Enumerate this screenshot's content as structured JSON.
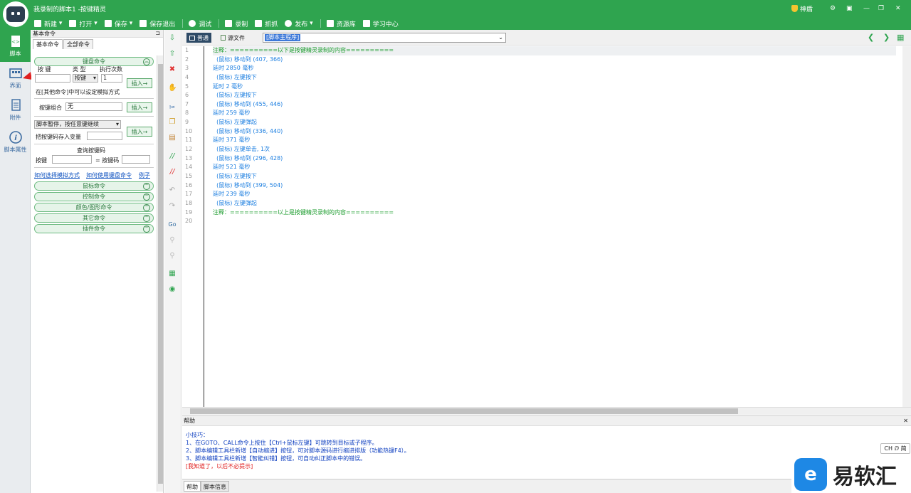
{
  "window": {
    "title": "我录制的脚本1 -按键精灵",
    "right_controls": {
      "shield_label": "神盾",
      "minimize": "—",
      "restore": "❐",
      "close": "✕"
    }
  },
  "toolbar": {
    "items": [
      {
        "label": "新建",
        "icon": "plus-icon"
      },
      {
        "label": "打开",
        "icon": "folder-icon"
      },
      {
        "label": "保存",
        "icon": "save-icon"
      },
      {
        "label": "保存退出",
        "icon": "save-exit-icon"
      },
      {
        "label": "调试",
        "icon": "play-icon"
      },
      {
        "label": "录制",
        "icon": "record-icon"
      },
      {
        "label": "抓抓",
        "icon": "grab-icon"
      },
      {
        "label": "发布",
        "icon": "publish-icon"
      },
      {
        "label": "资源库",
        "icon": "resource-icon"
      },
      {
        "label": "学习中心",
        "icon": "learn-icon"
      }
    ]
  },
  "leftnav": {
    "items": [
      {
        "label": "脚本",
        "icon": "script-icon",
        "active": true
      },
      {
        "label": "界面",
        "icon": "interface-icon",
        "active": false
      },
      {
        "label": "附件",
        "icon": "attachment-icon",
        "active": false
      },
      {
        "label": "脚本属性",
        "icon": "info-icon",
        "active": false
      }
    ]
  },
  "panel": {
    "title": "基本命令",
    "pin": "⊐",
    "tabs": [
      "基本命令",
      "全部命令"
    ],
    "key_section": {
      "header": "键盘命令",
      "col_key": "按 键",
      "col_type": "类 型",
      "col_count": "执行次数",
      "type_value": "按键",
      "count_value": "1",
      "insert": "插入→",
      "note": "在[其他命令]中可以设定模拟方式",
      "combo_label": "按键组合",
      "combo_value": "无",
      "combo_insert": "插入→",
      "pause_value": "脚本暂停，按任意键继续",
      "save_key_label": "把按键码存入变量",
      "pause_insert": "插入→",
      "query_title": "查询按键码",
      "query_key_label": "按键",
      "query_code_label": "= 按键码",
      "links": [
        "如何选择模拟方式",
        "如何使用键盘命令",
        "例子"
      ]
    },
    "sections": [
      "鼠标命令",
      "控制命令",
      "颜色/图形命令",
      "其它命令",
      "插件命令"
    ]
  },
  "editor": {
    "tabs": [
      "普通",
      "源文件"
    ],
    "combo_value": "[脚本主程序]",
    "lines": [
      {
        "n": "1",
        "text": "注释：==========以下是按键精灵录制的内容==========",
        "color": "green"
      },
      {
        "n": "2",
        "text": "  (鼠标) 移动到 (407, 366)",
        "color": "blue"
      },
      {
        "n": "3",
        "text": "延时 2850 毫秒",
        "color": "blue"
      },
      {
        "n": "4",
        "text": "  (鼠标) 左键按下",
        "color": "blue"
      },
      {
        "n": "5",
        "text": "延时 2 毫秒",
        "color": "blue"
      },
      {
        "n": "6",
        "text": "  (鼠标) 左键按下",
        "color": "blue"
      },
      {
        "n": "7",
        "text": "  (鼠标) 移动到 (455, 446)",
        "color": "blue"
      },
      {
        "n": "8",
        "text": "延时 259 毫秒",
        "color": "blue"
      },
      {
        "n": "9",
        "text": "  (鼠标) 左键弹起",
        "color": "blue"
      },
      {
        "n": "10",
        "text": "  (鼠标) 移动到 (336, 440)",
        "color": "blue"
      },
      {
        "n": "11",
        "text": "延时 371 毫秒",
        "color": "blue"
      },
      {
        "n": "12",
        "text": "  (鼠标) 左键单击, 1次",
        "color": "blue"
      },
      {
        "n": "13",
        "text": "  (鼠标) 移动到 (296, 428)",
        "color": "blue"
      },
      {
        "n": "14",
        "text": "延时 521 毫秒",
        "color": "blue"
      },
      {
        "n": "15",
        "text": "  (鼠标) 左键按下",
        "color": "blue"
      },
      {
        "n": "16",
        "text": "  (鼠标) 移动到 (399, 504)",
        "color": "blue"
      },
      {
        "n": "17",
        "text": "延时 239 毫秒",
        "color": "blue"
      },
      {
        "n": "18",
        "text": "  (鼠标) 左键弹起",
        "color": "blue"
      },
      {
        "n": "19",
        "text": "注释：==========以上是按键精灵录制的内容==========",
        "color": "green"
      },
      {
        "n": "20",
        "text": "",
        "color": "blue"
      }
    ]
  },
  "help": {
    "title": "帮助",
    "tips": [
      "小技巧：",
      "1、在GOTO、CALL命令上按住【Ctrl+鼠标左键】可跳转到目标或子程序。",
      "2、脚本编辑工具栏新增【自动缩进】按钮，可对脚本源码进行缩进排版（功能热键F4）。",
      "3、脚本编辑工具栏新增【智能纠错】按钮，可自动纠正脚本中的错误。"
    ],
    "dismiss": "[我知道了，以后不必提示]"
  },
  "bottom_tabs": [
    "帮助",
    "脚本信息"
  ],
  "ime_badge": "CH ⅅ 简",
  "watermark": {
    "text": "易软汇"
  },
  "colors": {
    "accent": "#2fa44f",
    "code_green": "#199b2b",
    "code_blue": "#1b7ee0"
  }
}
